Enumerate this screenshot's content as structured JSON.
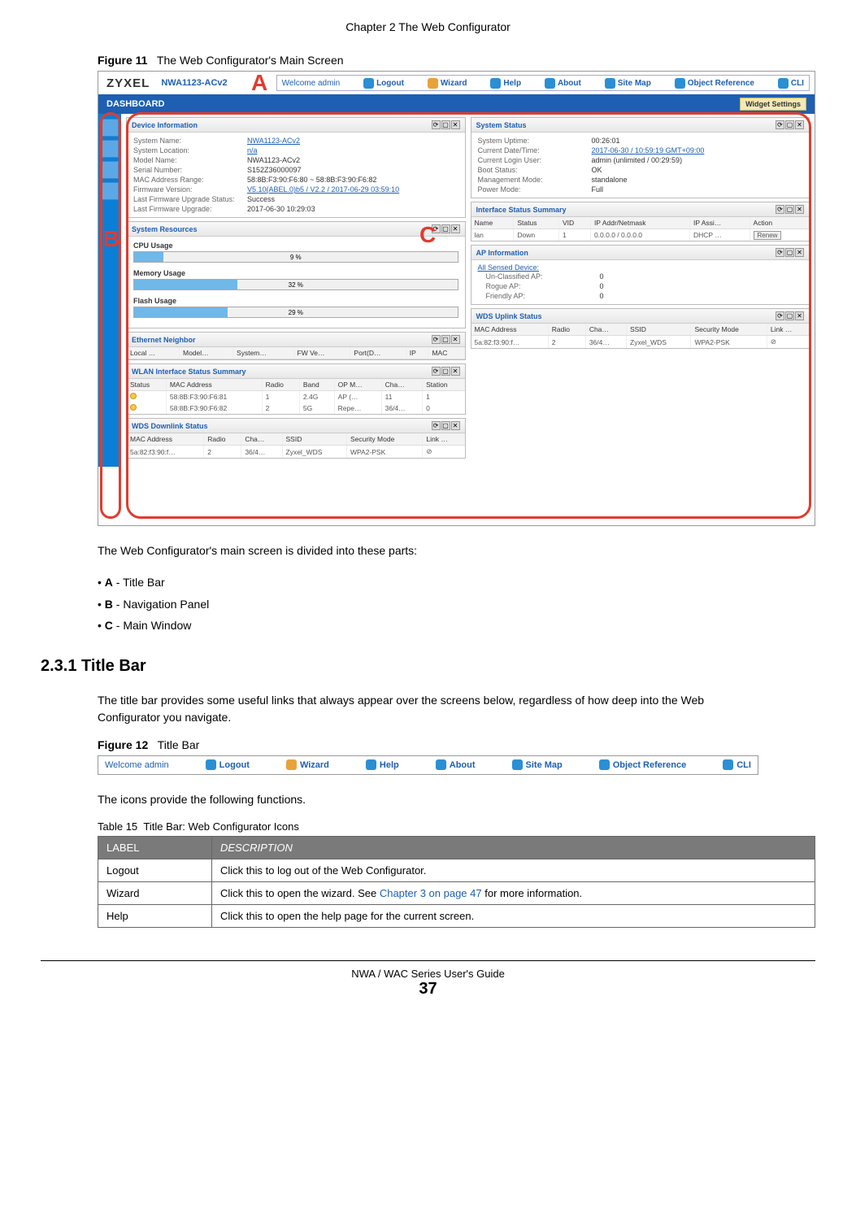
{
  "chapter_header": "Chapter 2 The Web Configurator",
  "figure11": {
    "label": "Figure 11",
    "caption": "The Web Configurator's Main Screen"
  },
  "screenshot": {
    "logo": "ZYXEL",
    "model": "NWA1123-ACv2",
    "titlebar": {
      "welcome": "Welcome admin",
      "links": [
        "Logout",
        "Wizard",
        "Help",
        "About",
        "Site Map",
        "Object Reference",
        "CLI"
      ]
    },
    "dashboard_label": "DASHBOARD",
    "widget_settings": "Widget Settings",
    "callouts": {
      "A": "A",
      "B": "B",
      "C": "C"
    },
    "device_info": {
      "title": "Device Information",
      "rows": [
        {
          "label": "System Name:",
          "value": "NWA1123-ACv2",
          "link": true
        },
        {
          "label": "System Location:",
          "value": "n/a",
          "link": true
        },
        {
          "label": "Model Name:",
          "value": "NWA1123-ACv2"
        },
        {
          "label": "Serial Number:",
          "value": "S152Z36000097"
        },
        {
          "label": "MAC Address Range:",
          "value": "58:8B:F3:90:F6:80 ~ 58:8B:F3:90:F6:82"
        },
        {
          "label": "Firmware Version:",
          "value": "V5.10(ABEL.0)b5 / V2.2 / 2017-06-29 03:59:10",
          "link": true
        },
        {
          "label": "Last Firmware Upgrade Status:",
          "value": "Success"
        },
        {
          "label": "Last Firmware Upgrade:",
          "value": "2017-06-30 10:29:03"
        }
      ]
    },
    "system_resources": {
      "title": "System Resources",
      "bars": [
        {
          "label": "CPU Usage",
          "pct": 9,
          "text": "9 %"
        },
        {
          "label": "Memory Usage",
          "pct": 32,
          "text": "32 %"
        },
        {
          "label": "Flash Usage",
          "pct": 29,
          "text": "29 %"
        }
      ]
    },
    "ethernet_neighbor": {
      "title": "Ethernet Neighbor",
      "headers": [
        "Local …",
        "Model…",
        "System…",
        "FW Ve…",
        "Port(D…",
        "IP",
        "MAC"
      ]
    },
    "wlan_summary": {
      "title": "WLAN Interface Status Summary",
      "headers": [
        "Status",
        "MAC Address",
        "Radio",
        "Band",
        "OP M…",
        "Cha…",
        "Station"
      ],
      "rows": [
        [
          "●",
          "58:8B:F3:90:F6:81",
          "1",
          "2.4G",
          "AP (…",
          "11",
          "1"
        ],
        [
          "●",
          "58:8B:F3:90:F6:82",
          "2",
          "5G",
          "Repe…",
          "36/4…",
          "0"
        ]
      ]
    },
    "wds_downlink": {
      "title": "WDS Downlink Status",
      "headers": [
        "MAC Address",
        "Radio",
        "Cha…",
        "SSID",
        "Security Mode",
        "Link …"
      ],
      "rows": [
        [
          "5a:82:f3:90:f…",
          "2",
          "36/4…",
          "Zyxel_WDS",
          "WPA2-PSK",
          "⊘"
        ]
      ]
    },
    "system_status": {
      "title": "System Status",
      "rows": [
        {
          "label": "System Uptime:",
          "value": "00:26:01"
        },
        {
          "label": "Current Date/Time:",
          "value": "2017-06-30 / 10:59:19 GMT+09:00",
          "link": true
        },
        {
          "label": "Current Login User:",
          "value": "admin (unlimited / 00:29:59)"
        },
        {
          "label": "Boot Status:",
          "value": "OK"
        },
        {
          "label": "Management Mode:",
          "value": "standalone"
        },
        {
          "label": "Power Mode:",
          "value": "Full"
        }
      ]
    },
    "interface_status": {
      "title": "Interface Status Summary",
      "headers": [
        "Name",
        "Status",
        "VID",
        "IP Addr/Netmask",
        "IP Assi…",
        "Action"
      ],
      "rows": [
        [
          "lan",
          "Down",
          "1",
          "0.0.0.0 / 0.0.0.0",
          "DHCP …",
          "Renew"
        ]
      ]
    },
    "ap_info": {
      "title": "AP Information",
      "all_sensed": "All Sensed Device:",
      "rows": [
        {
          "label": "Un-Classified AP:",
          "value": "0"
        },
        {
          "label": "Rogue AP:",
          "value": "0"
        },
        {
          "label": "Friendly AP:",
          "value": "0"
        }
      ]
    },
    "wds_uplink": {
      "title": "WDS Uplink Status",
      "headers": [
        "MAC Address",
        "Radio",
        "Cha…",
        "SSID",
        "Security Mode",
        "Link …"
      ],
      "rows": [
        [
          "5a:82:f3:90:f…",
          "2",
          "36/4…",
          "Zyxel_WDS",
          "WPA2-PSK",
          "⊘"
        ]
      ]
    }
  },
  "intro_text": "The Web Configurator's main screen is divided into these parts:",
  "bullets": [
    {
      "bold": "A",
      "rest": " - Title Bar"
    },
    {
      "bold": "B",
      "rest": " - Navigation Panel"
    },
    {
      "bold": "C",
      "rest": " - Main Window"
    }
  ],
  "section_231": "2.3.1  Title Bar",
  "section_231_text": "The title bar provides some useful links that always appear over the screens below, regardless of how deep into the Web Configurator you navigate.",
  "figure12": {
    "label": "Figure 12",
    "caption": "Title Bar"
  },
  "icons_text": "The icons provide the following functions.",
  "table15": {
    "caption_label": "Table 15",
    "caption": "Title Bar: Web Configurator Icons",
    "headers": [
      "LABEL",
      "DESCRIPTION"
    ],
    "rows": [
      {
        "label": "Logout",
        "desc": "Click this to log out of the Web Configurator.",
        "link": ""
      },
      {
        "label": "Wizard",
        "desc_pre": "Click this to open the wizard. See ",
        "link": "Chapter 3 on page 47",
        "desc_post": " for more information."
      },
      {
        "label": "Help",
        "desc": "Click this to open the help page for the current screen.",
        "link": ""
      }
    ]
  },
  "footer": {
    "guide": "NWA / WAC Series User's Guide",
    "page": "37"
  }
}
